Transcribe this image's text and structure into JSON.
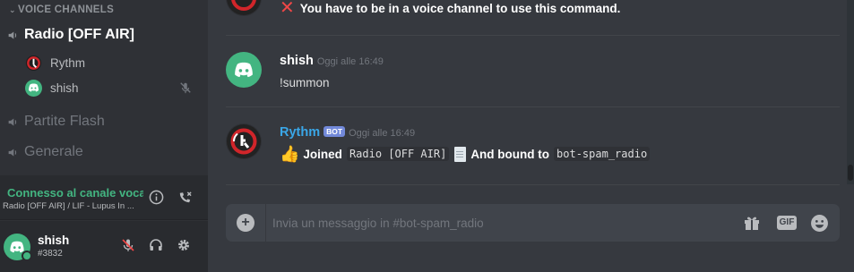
{
  "sidebar": {
    "section_header": "VOICE CHANNELS",
    "channels": [
      {
        "name": "Radio [OFF AIR]",
        "active": true
      },
      {
        "name": "Partite Flash",
        "active": false
      },
      {
        "name": "Generale",
        "active": false
      }
    ],
    "voice_users": [
      {
        "name": "Rythm",
        "icon": "rythm-avatar"
      },
      {
        "name": "shish",
        "icon": "discord-avatar",
        "muted": true
      }
    ]
  },
  "voice_panel": {
    "status": "Connesso al canale vocale",
    "channel_info": "Radio [OFF AIR] / LIF - Lupus In ..."
  },
  "user_panel": {
    "username": "shish",
    "discriminator": "#3832"
  },
  "chat": {
    "error_message": "You have to be in a voice channel to use this command.",
    "messages": [
      {
        "author": "shish",
        "timestamp": "Oggi alle 16:49",
        "text": "!summon",
        "author_color": "#ffffff"
      },
      {
        "author": "Rythm",
        "badge": "BOT",
        "timestamp": "Oggi alle 16:49",
        "author_color": "#3aa7e8",
        "parts": {
          "joined": "Joined",
          "channel_code": "Radio [OFF AIR]",
          "bound": "And bound to",
          "bound_code": "bot-spam_radio"
        }
      }
    ]
  },
  "composer": {
    "placeholder": "Invia un messaggio in #bot-spam_radio",
    "gif_label": "GIF"
  },
  "colors": {
    "online_green": "#43b581",
    "bot_badge": "#7289da",
    "rythm_name": "#3aa7e8",
    "error_red": "#f04747"
  }
}
